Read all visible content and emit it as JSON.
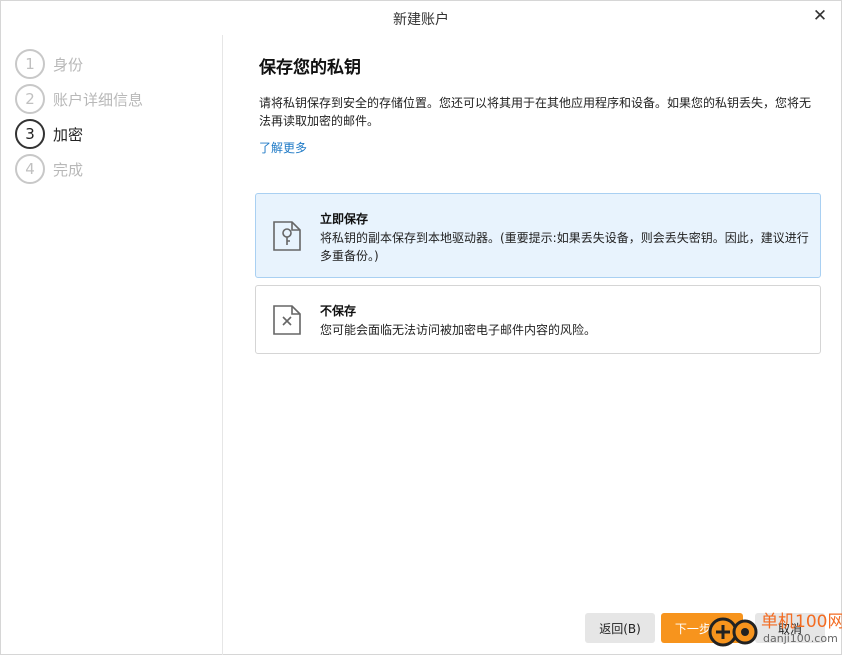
{
  "window": {
    "title": "新建账户",
    "close_glyph": "✕"
  },
  "sidebar": {
    "steps": [
      {
        "num": "1",
        "label": "身份"
      },
      {
        "num": "2",
        "label": "账户详细信息"
      },
      {
        "num": "3",
        "label": "加密"
      },
      {
        "num": "4",
        "label": "完成"
      }
    ],
    "active_step": 3
  },
  "main": {
    "heading": "保存您的私钥",
    "description": "请将私钥保存到安全的存储位置。您还可以将其用于在其他应用程序和设备。如果您的私钥丢失，您将无法再读取加密的邮件。",
    "learn_more": "了解更多",
    "options": [
      {
        "title": "立即保存",
        "text": "将私钥的副本保存到本地驱动器。(重要提示:如果丢失设备，则会丢失密钥。因此，建议进行多重备份。)",
        "icon": "key-icon",
        "selected": true
      },
      {
        "title": "不保存",
        "text": "您可能会面临无法访问被加密电子邮件内容的风险。",
        "icon": "cross-file-icon",
        "selected": false
      }
    ]
  },
  "footer": {
    "back_label": "返回(B)",
    "next_label": "下一步(N)",
    "cancel_label": "取消"
  },
  "watermark": {
    "line1": "单机100网",
    "line2": "danji100.com"
  },
  "colors": {
    "accent": "#f7941d",
    "link": "#1f7ac6",
    "selected_bg": "#e8f3fd",
    "selected_border": "#a9d0f2"
  }
}
